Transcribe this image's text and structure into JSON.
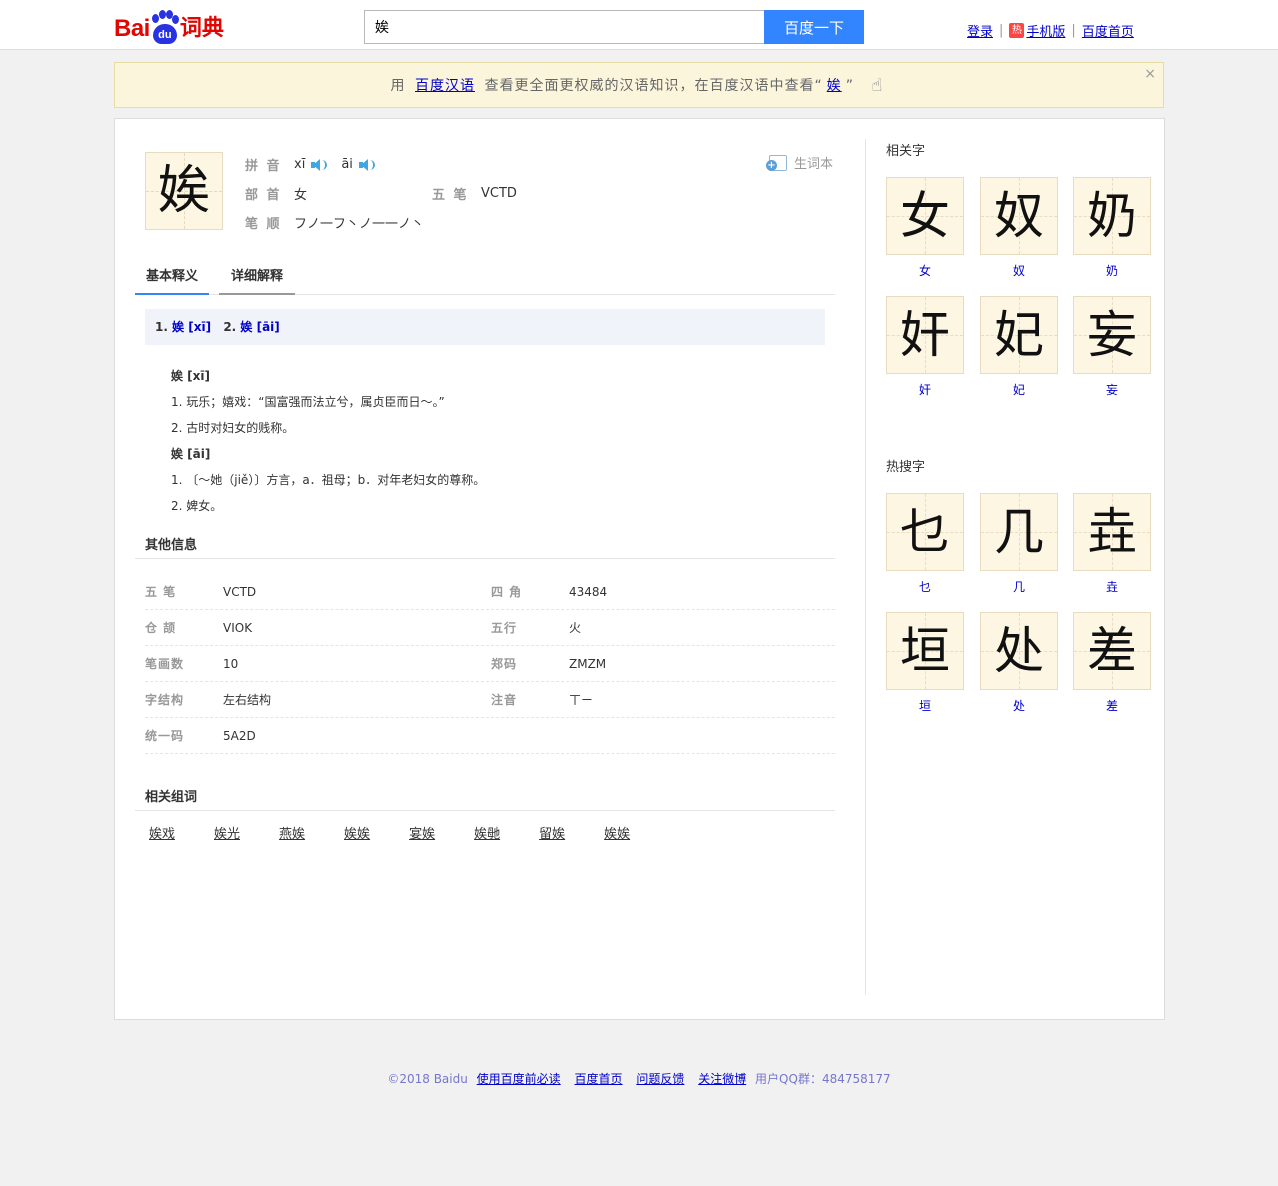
{
  "header": {
    "logo_bai": "Bai",
    "logo_du": "du",
    "logo_cidian": "词典",
    "search_value": "娭",
    "search_button": "百度一下",
    "links": {
      "login": "登录",
      "hot_badge": "热",
      "mobile": "手机版",
      "home": "百度首页"
    }
  },
  "notice": {
    "prefix": "用",
    "link1": "百度汉语",
    "middle": "查看更全面更权威的汉语知识，在百度汉语中查看“",
    "link2": "娭",
    "suffix": "”",
    "close": "×"
  },
  "entry": {
    "char": "娭",
    "pinyin_label": "拼 音",
    "pinyin1": "xī",
    "pinyin2": "āi",
    "radical_label": "部 首",
    "radical": "女",
    "wubi_label": "五 笔",
    "wubi": "VCTD",
    "strokes_label": "笔 顺",
    "strokes": "フノ一フ丶ノ一一ノ丶",
    "vocab": "生词本"
  },
  "tabs": {
    "basic": "基本释义",
    "detail": "详细解释"
  },
  "nav": {
    "n1": "1.",
    "l1": "娭 [xī]",
    "n2": "2.",
    "l2": "娭 [āi]"
  },
  "defs": {
    "h1": "娭 [xī]",
    "d1": "1. 玩乐；嬉戏：“国富强而法立兮，属贞臣而日～。”",
    "d2": "2. 古时对妇女的贱称。",
    "h2": "娭 [āi]",
    "d3": "1. 〔～她（jiě）〕方言，a．祖母；b．对年老妇女的尊称。",
    "d4": "2. 婢女。"
  },
  "other": {
    "title": "其他信息",
    "rows": [
      {
        "l1": "五 笔",
        "v1": "VCTD",
        "l2": "四 角",
        "v2": "43484"
      },
      {
        "l1": "仓 颉",
        "v1": "VIOK",
        "l2": "五行",
        "v2": "火"
      },
      {
        "l1": "笔画数",
        "v1": "10",
        "l2": "郑码",
        "v2": "ZMZM"
      },
      {
        "l1": "字结构",
        "v1": "左右结构",
        "l2": "注音",
        "v2": "ㄒㄧ"
      },
      {
        "l1": "统一码",
        "v1": "5A2D",
        "l2": "",
        "v2": ""
      }
    ]
  },
  "related_words": {
    "title": "相关组词",
    "items": [
      "娭戏",
      "娭光",
      "燕娭",
      "娭娭",
      "宴娭",
      "娭毑",
      "留娭",
      "娭娭"
    ]
  },
  "related_chars": {
    "title": "相关字",
    "items": [
      "女",
      "奴",
      "奶",
      "奸",
      "妃",
      "妄"
    ]
  },
  "hot_chars": {
    "title": "热搜字",
    "items": [
      "乜",
      "几",
      "垚",
      "垣",
      "处",
      "差"
    ]
  },
  "footer": {
    "copy": "©2018 Baidu",
    "l1": "使用百度前必读",
    "l2": "百度首页",
    "l3": "问题反馈",
    "l4": "关注微博",
    "qq": "用户QQ群：484758177"
  }
}
